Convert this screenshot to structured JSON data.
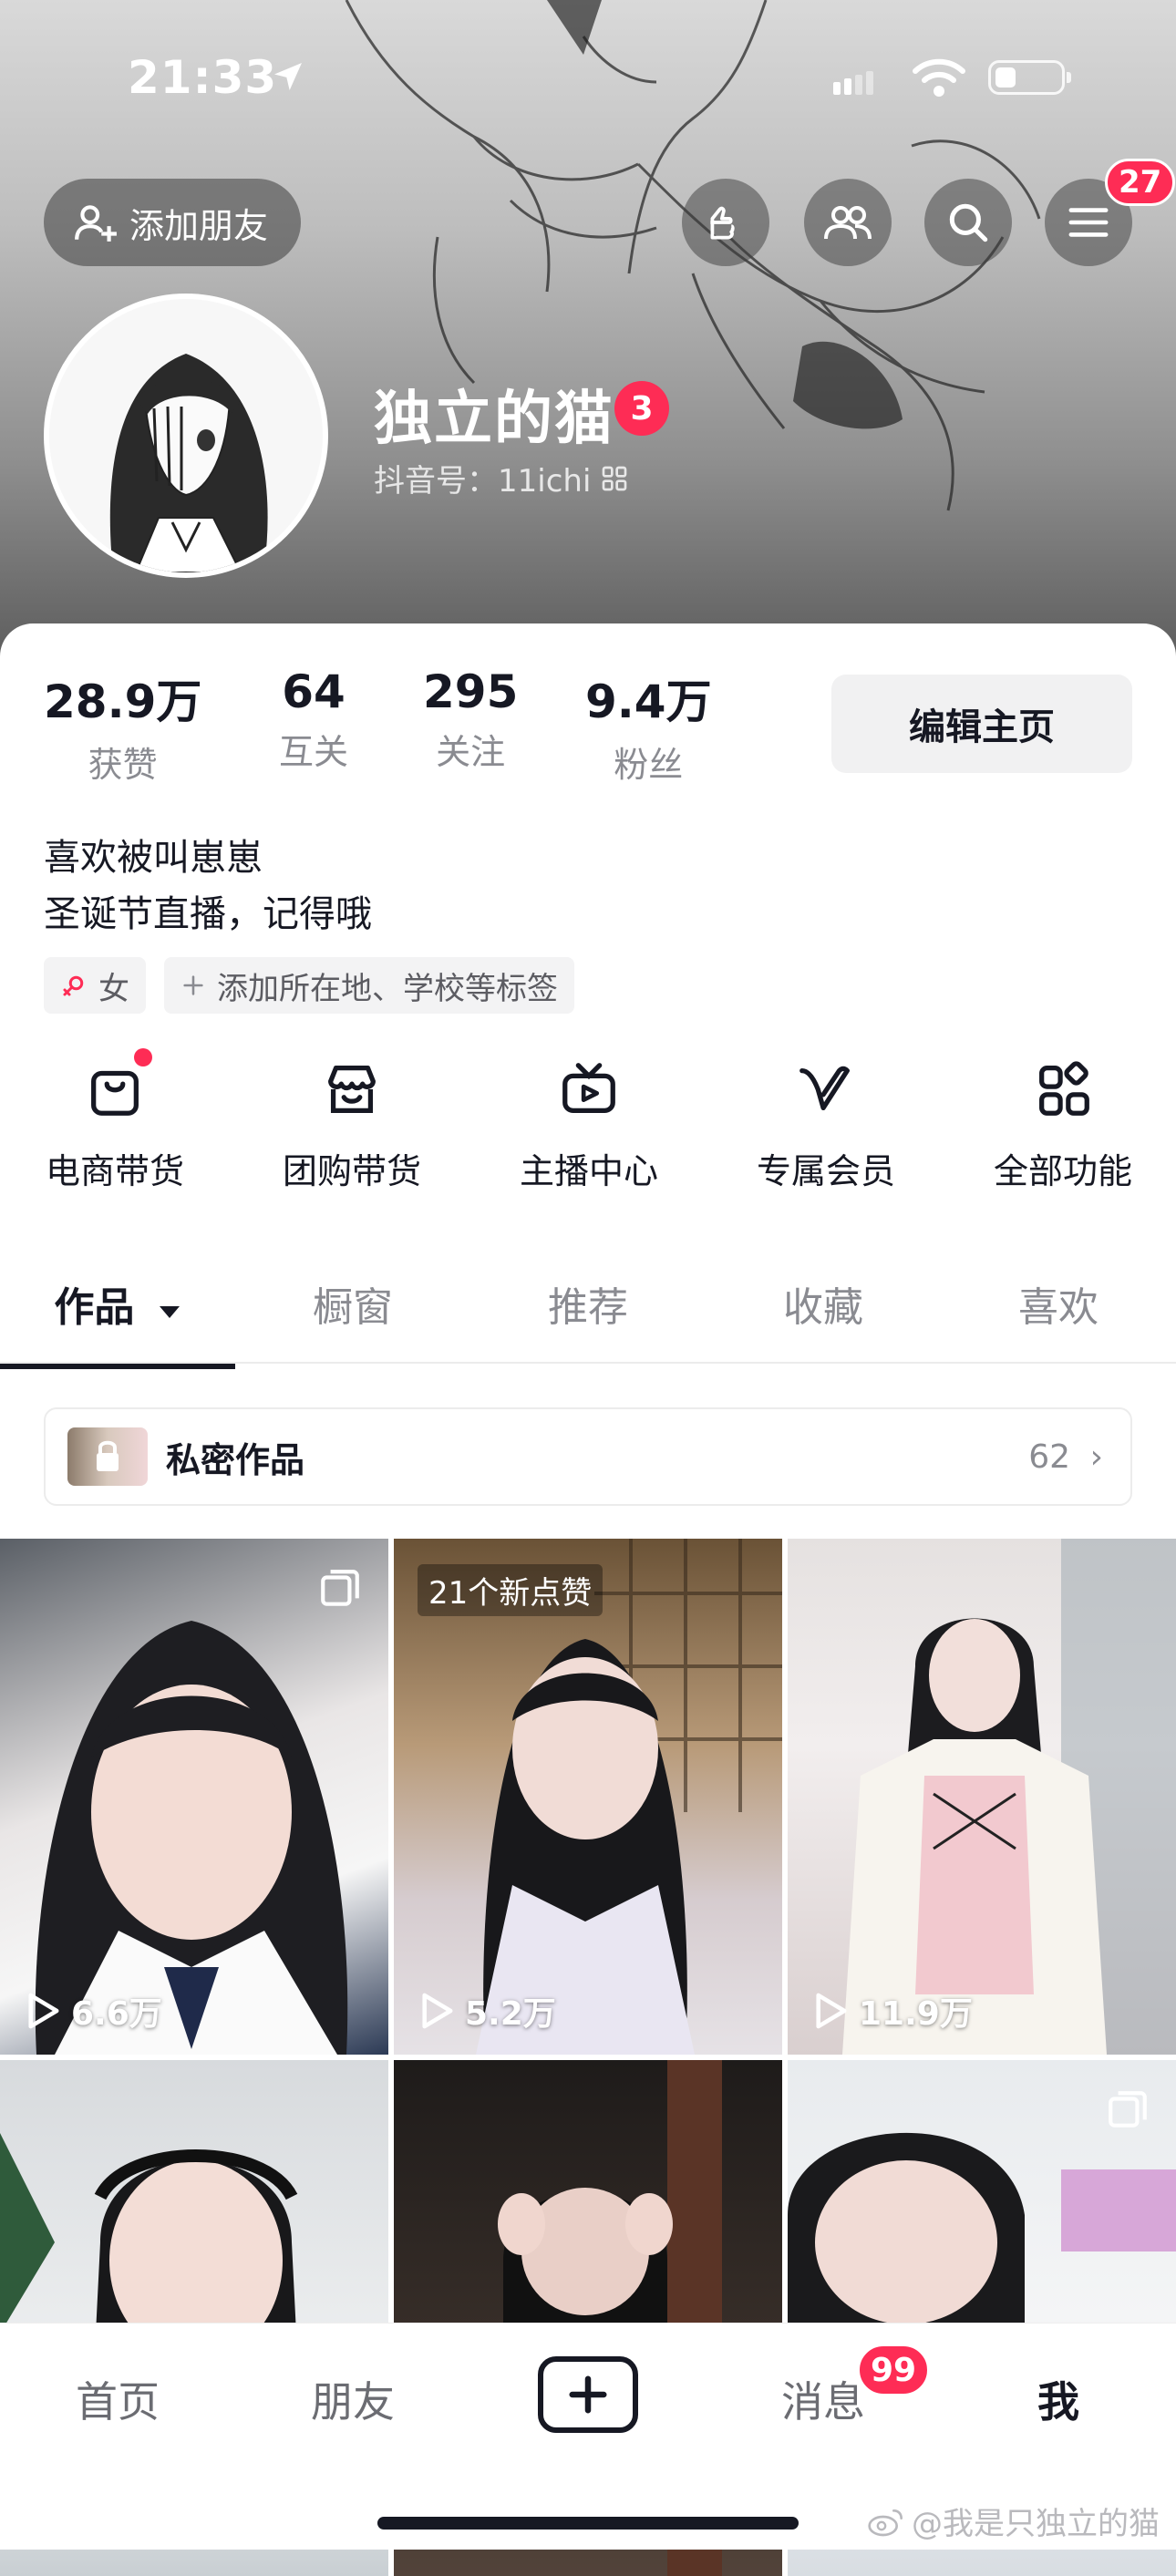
{
  "status_bar": {
    "time": "21:33"
  },
  "header": {
    "add_friend_label": "添加朋友",
    "menu_badge": "27"
  },
  "profile": {
    "nickname": "独立的猫",
    "nickname_badge": "3",
    "douyin_id": "抖音号：11ichi"
  },
  "stats": [
    {
      "value": "28.9万",
      "label": "获赞"
    },
    {
      "value": "64",
      "label": "互关"
    },
    {
      "value": "295",
      "label": "关注"
    },
    {
      "value": "9.4万",
      "label": "粉丝"
    }
  ],
  "edit_profile_label": "编辑主页",
  "bio": {
    "line1": "喜欢被叫崽崽",
    "line2": "圣诞节直播，记得哦"
  },
  "tags": {
    "gender": "女",
    "add_tag": "添加所在地、学校等标签"
  },
  "functions": [
    {
      "label": "电商带货",
      "icon": "shopping-bag-icon"
    },
    {
      "label": "团购带货",
      "icon": "store-icon"
    },
    {
      "label": "主播中心",
      "icon": "live-tv-icon"
    },
    {
      "label": "专属会员",
      "icon": "vip-icon"
    },
    {
      "label": "全部功能",
      "icon": "grid-icon"
    }
  ],
  "tabs": [
    {
      "label": "作品"
    },
    {
      "label": "橱窗"
    },
    {
      "label": "推荐"
    },
    {
      "label": "收藏"
    },
    {
      "label": "喜欢"
    }
  ],
  "private_works": {
    "title": "私密作品",
    "count": "62"
  },
  "videos": [
    {
      "plays": "6.6万",
      "multi": true
    },
    {
      "plays": "5.2万",
      "label": "21个新点赞"
    },
    {
      "plays": "11.9万"
    },
    {
      "plays": ""
    },
    {
      "plays": ""
    },
    {
      "plays": "",
      "multi": true
    }
  ],
  "bottom_nav": {
    "home": "首页",
    "friends": "朋友",
    "messages": "消息",
    "messages_badge": "99",
    "me": "我"
  },
  "watermark": "@我是只独立的猫",
  "colors": {
    "accent": "#fe2c55",
    "text": "#161823",
    "muted": "#8a8b91"
  }
}
